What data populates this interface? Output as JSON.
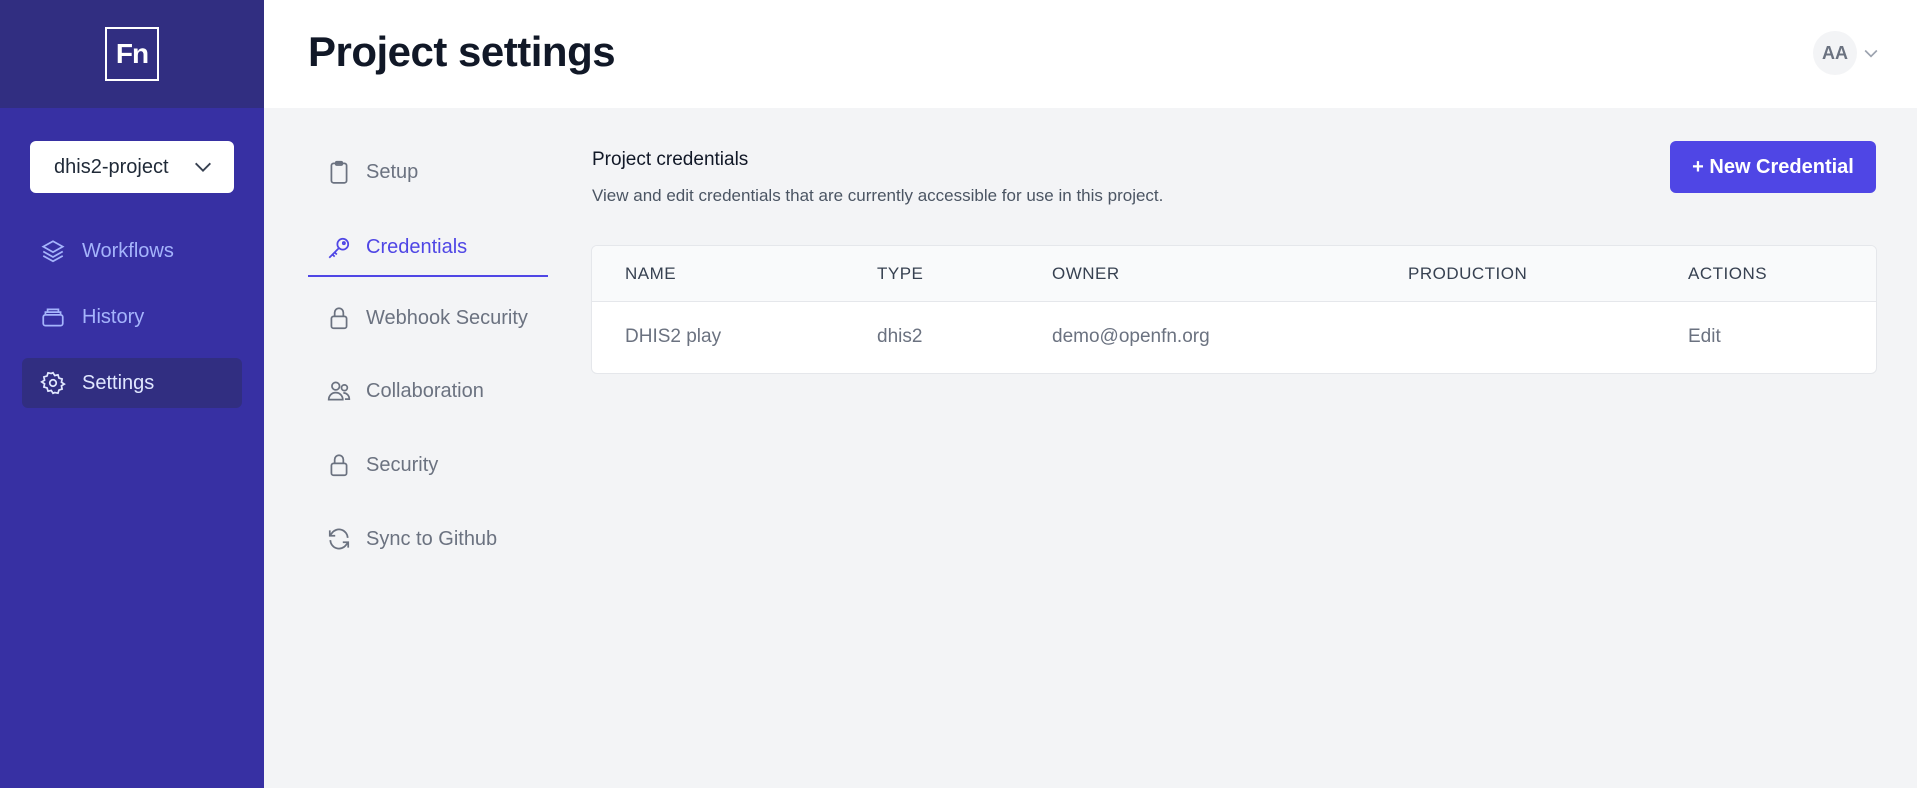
{
  "sidebar": {
    "logo_text": "Fn",
    "project_selector": "dhis2-project",
    "items": [
      {
        "label": "Workflows",
        "icon": "layers-icon"
      },
      {
        "label": "History",
        "icon": "archive-box-icon"
      },
      {
        "label": "Settings",
        "icon": "gear-icon",
        "active": true
      }
    ]
  },
  "header": {
    "title": "Project settings",
    "avatar_initials": "AA"
  },
  "settings_nav": {
    "items": [
      {
        "label": "Setup",
        "icon": "clipboard-icon"
      },
      {
        "label": "Credentials",
        "icon": "key-icon",
        "active": true
      },
      {
        "label": "Webhook Security",
        "icon": "lock-icon"
      },
      {
        "label": "Collaboration",
        "icon": "users-icon"
      },
      {
        "label": "Security",
        "icon": "lock-icon"
      },
      {
        "label": "Sync to Github",
        "icon": "refresh-icon"
      }
    ]
  },
  "main": {
    "section_title": "Project credentials",
    "section_description": "View and edit credentials that are currently accessible for use in this project.",
    "new_button": "+ New Credential",
    "table": {
      "columns": [
        "NAME",
        "TYPE",
        "OWNER",
        "PRODUCTION",
        "ACTIONS"
      ],
      "rows": [
        {
          "name": "DHIS2 play",
          "type": "dhis2",
          "owner": "demo@openfn.org",
          "production": "",
          "action": "Edit"
        }
      ]
    }
  },
  "colors": {
    "sidebar_bg": "#3730a3",
    "sidebar_top_bg": "#312e81",
    "accent": "#4f46e5",
    "page_bg": "#f3f4f6"
  }
}
